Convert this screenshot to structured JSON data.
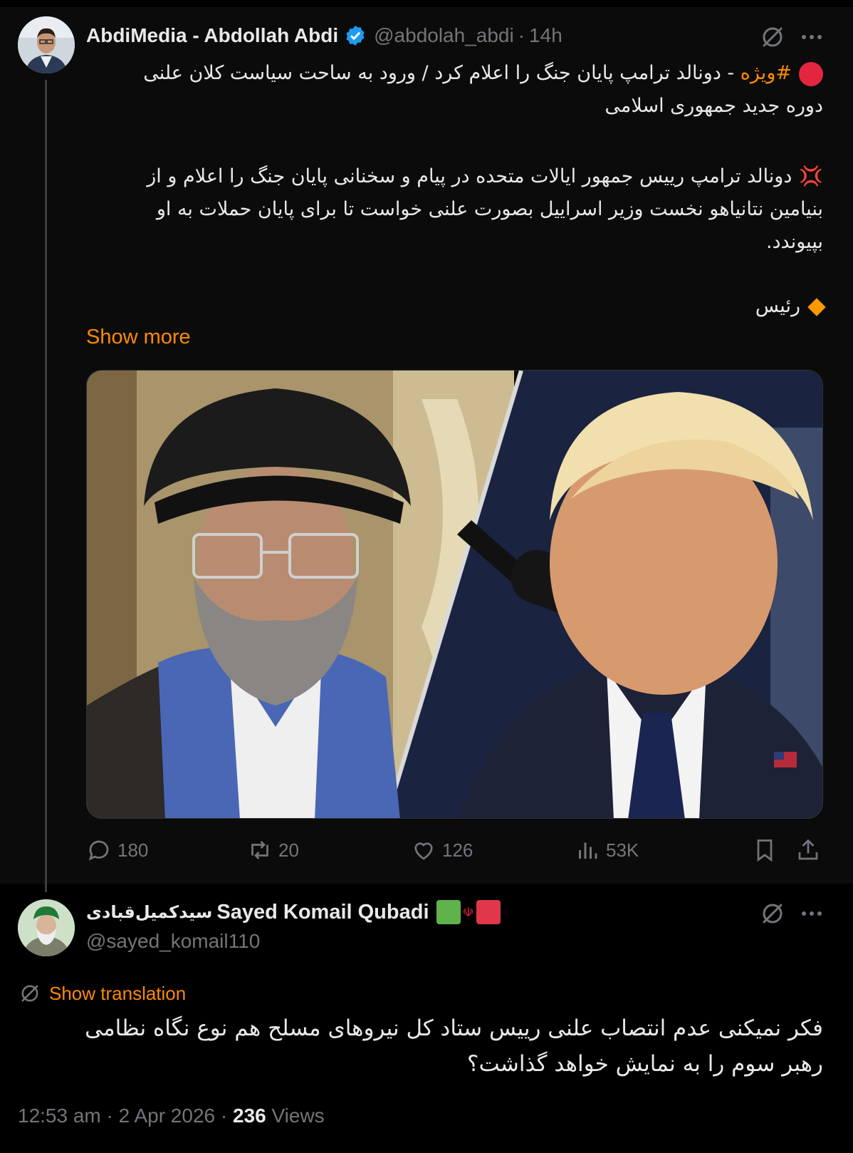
{
  "tweet": {
    "author": {
      "display_name": "AbdiMedia - Abdollah Abdi",
      "handle": "@abdolah_abdi",
      "verified": true,
      "time_ago": "14h"
    },
    "text": {
      "line1_hashtag": "#ویژه",
      "line1_rest": " - دونالد ترامپ پایان جنگ را اعلام کرد / ورود به ساحت سیاست کلان علنی دوره جدید جمهوری اسلامی",
      "para2": "دونالد ترامپ رییس جمهور ایالات متحده در پیام و سخنانی پایان جنگ را اعلام و از بنیامین نتانیاهو نخست وزیر اسراییل بصورت علنی خواست تا برای پایان حملات به او بپیوندد.",
      "para3": "رئیس"
    },
    "show_more": "Show more",
    "media_description": "photo",
    "stats": {
      "replies": "180",
      "reposts": "20",
      "likes": "126",
      "views": "53K"
    }
  },
  "reply": {
    "author": {
      "display_name": "Sayed Komail Qubadi",
      "display_name_persian": "سیدکمیل‌قبادی",
      "handle": "@sayed_komail110"
    },
    "show_translation": "Show translation",
    "text": "فکر نمیکنی عدم انتصاب علنی رییس ستاد کل نیروهای مسلح هم نوع نگاه نظامی رهبر سوم را به نمایش خواهد گذاشت؟",
    "time": "12:53 am",
    "date": "2 Apr 2026",
    "views_count": "236",
    "views_label": "Views"
  },
  "colors": {
    "accent": "#ff8a00",
    "verified": "#1d9bf0",
    "muted": "#71767b"
  }
}
